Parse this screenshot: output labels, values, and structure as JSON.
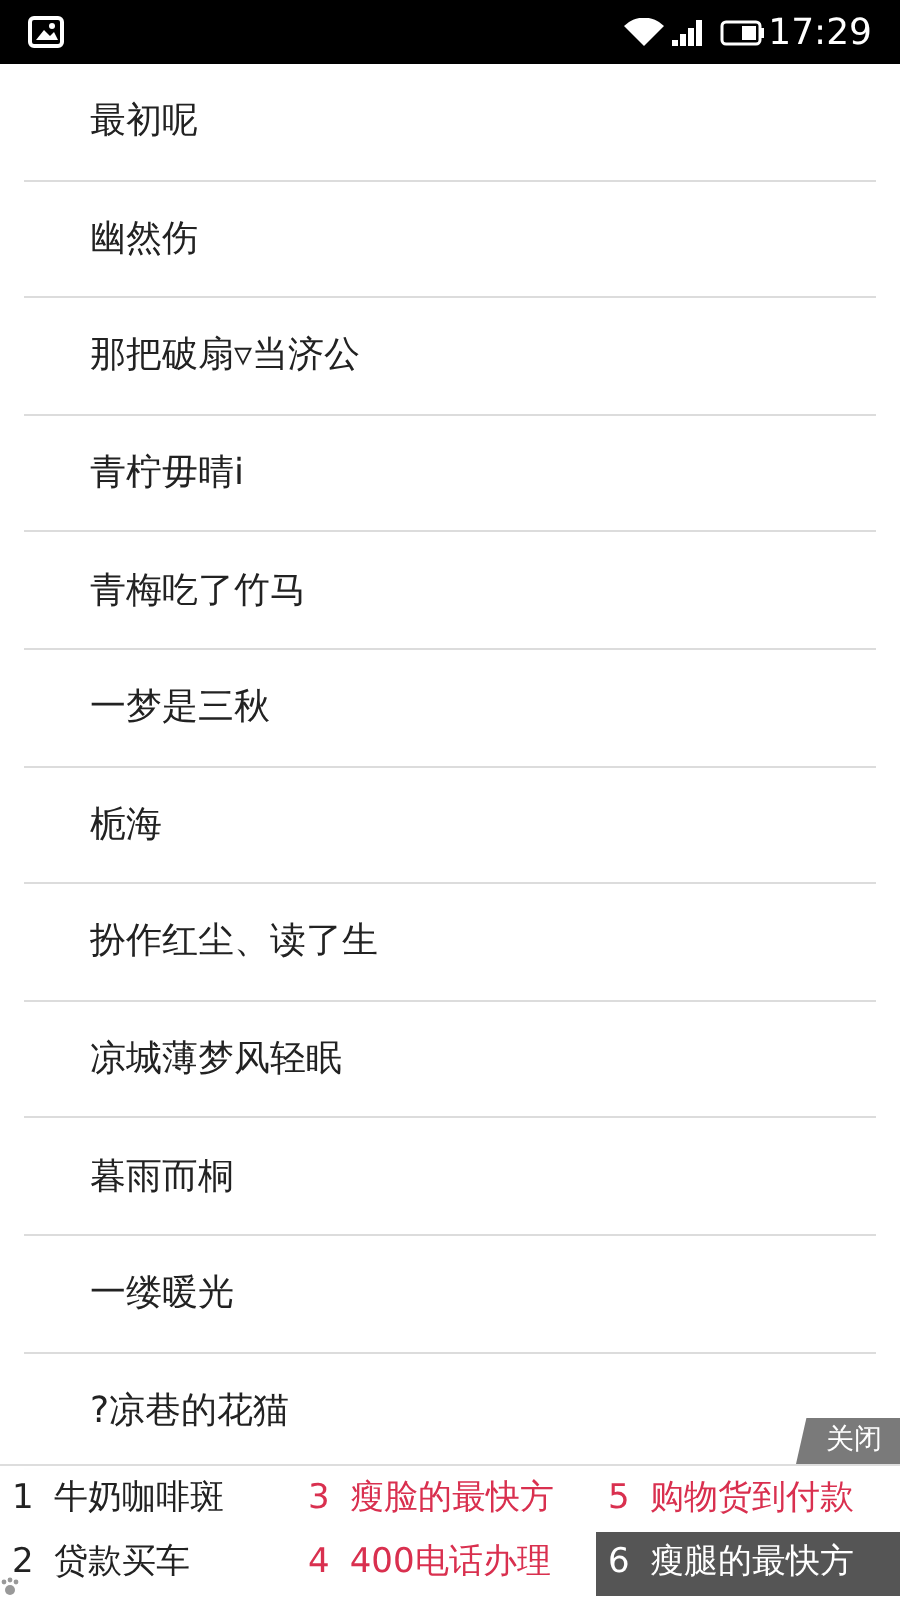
{
  "status_bar": {
    "time": "17:29"
  },
  "list": [
    {
      "label": "最初呢"
    },
    {
      "label": "幽然伤"
    },
    {
      "label": "那把破扇▿当济公"
    },
    {
      "label": "青柠毋晴i"
    },
    {
      "label": "青梅吃了竹马"
    },
    {
      "label": "一梦是三秋"
    },
    {
      "label": "栀海"
    },
    {
      "label": "扮作红尘、读了生"
    },
    {
      "label": "凉城薄梦风轻眠"
    },
    {
      "label": "暮雨而桐"
    },
    {
      "label": "一缕暖光"
    },
    {
      "label": "?凉巷的花猫"
    }
  ],
  "ad": {
    "close": "关闭",
    "items": [
      {
        "number": "1",
        "label": "牛奶咖啡斑",
        "color": "#222222",
        "selected": false
      },
      {
        "number": "2",
        "label": "贷款买车",
        "color": "#222222",
        "selected": false
      },
      {
        "number": "3",
        "label": "瘦脸的最快方",
        "color": "#d9304f",
        "selected": false
      },
      {
        "number": "4",
        "label": "400电话办理",
        "color": "#d9304f",
        "selected": false
      },
      {
        "number": "5",
        "label": "购物货到付款",
        "color": "#d9304f",
        "selected": false
      },
      {
        "number": "6",
        "label": "瘦腿的最快方",
        "color": "#ffffff",
        "selected": true
      }
    ]
  }
}
